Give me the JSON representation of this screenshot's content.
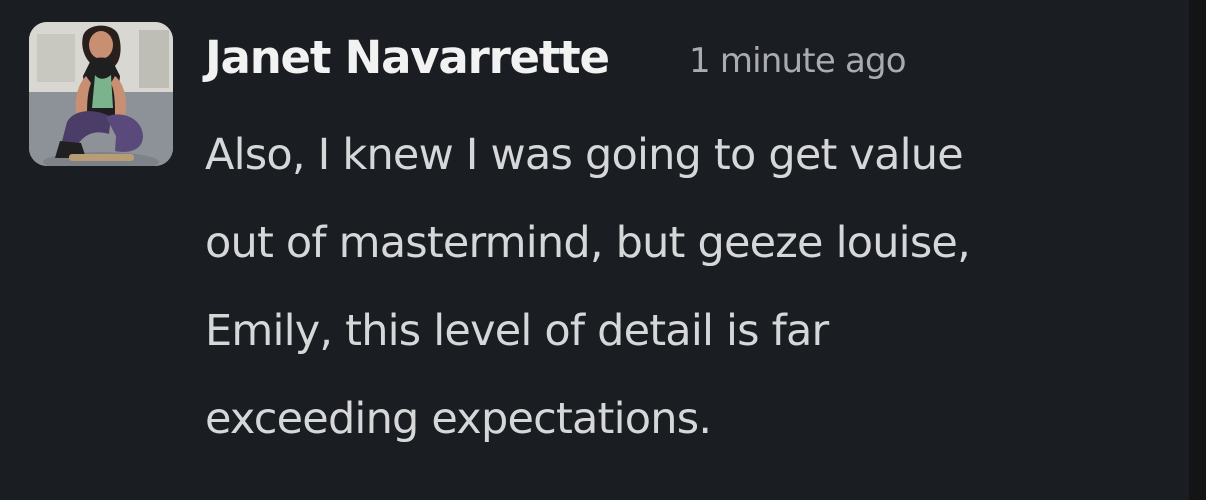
{
  "message": {
    "author": "Janet Navarrette",
    "timestamp": "1 minute ago",
    "text_lines": [
      "Also, I knew I was going to get value",
      "out of mastermind, but geeze louise,",
      "Emily, this level of detail is far",
      "exceeding expectations."
    ]
  },
  "colors": {
    "background": "#1a1d21",
    "author": "#f2f2f3",
    "timestamp": "#a9abae",
    "body_text": "#d6d7d8"
  },
  "icons": {
    "avatar": "user-profile-photo"
  }
}
